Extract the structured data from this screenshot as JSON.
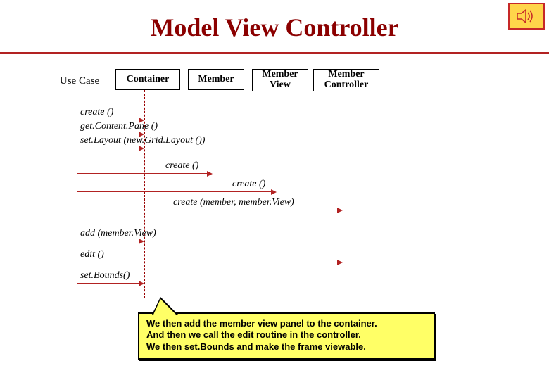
{
  "title": "Model View Controller",
  "participants": {
    "useCase": "Use Case",
    "container": "Container",
    "member": "Member",
    "memberView": "Member\nView",
    "memberController": "Member\nController"
  },
  "messages": {
    "create1": "create ()",
    "getContentPane": "get.Content.Pane ()",
    "setLayout": "set.Layout (new.Grid.Layout ())",
    "create2": "create ()",
    "create3": "create ()",
    "createMember": "create (member, member.View)",
    "addMemberView": "add (member.View)",
    "edit": "edit ()",
    "setBounds": "set.Bounds()"
  },
  "callout": {
    "line1": "We then add the member view panel to the container.",
    "line2": "And then we call the edit routine in the controller.",
    "line3": "We then set.Bounds and make the frame viewable."
  },
  "icons": {
    "speaker": "speaker-icon"
  }
}
